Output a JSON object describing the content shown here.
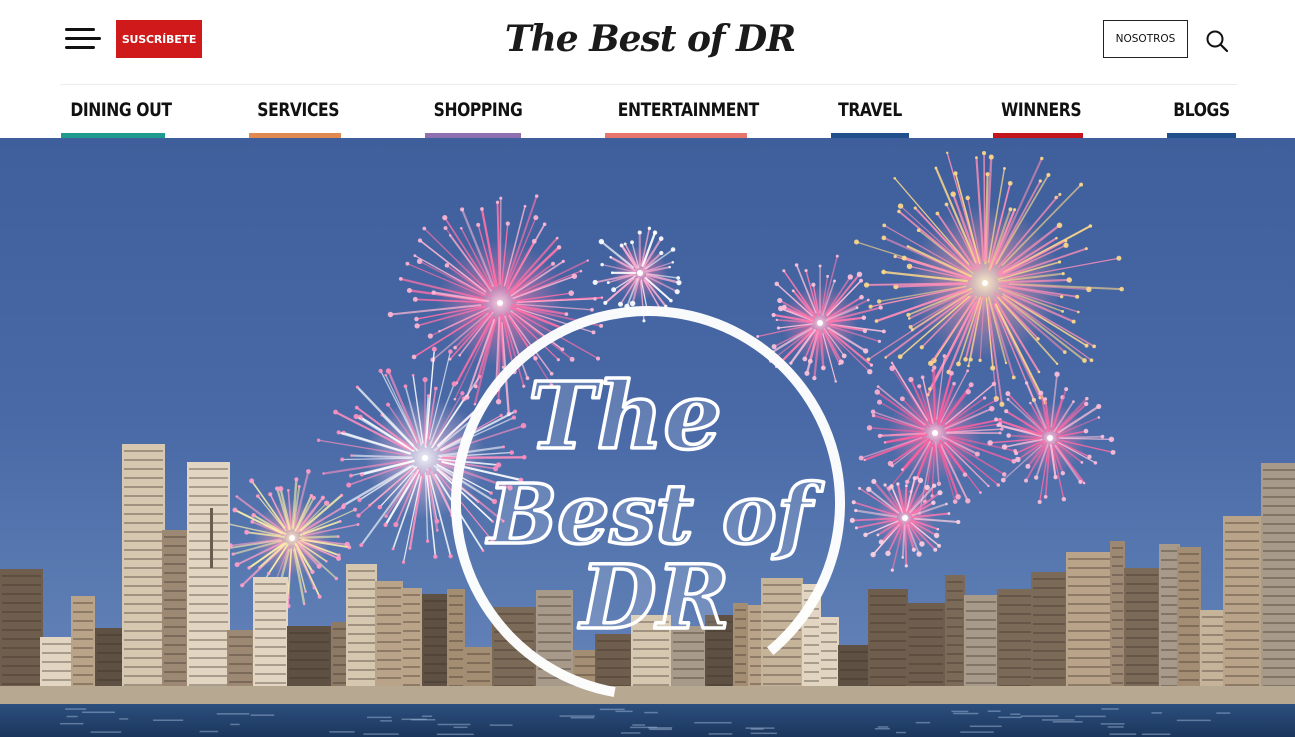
{
  "header": {
    "subscribe_label": "SUSCRÍBETE",
    "logo_text": "The Best of DR",
    "about_label": "NOSOTROS",
    "menu_icon": "hamburger-menu-icon",
    "search_icon": "search-icon"
  },
  "nav": {
    "items": [
      {
        "label": "DINING OUT",
        "color": "#1f9a8f"
      },
      {
        "label": "SERVICES",
        "color": "#e08a4f"
      },
      {
        "label": "SHOPPING",
        "color": "#8e6fb0"
      },
      {
        "label": "ENTERTAINMENT",
        "color": "#e8746e"
      },
      {
        "label": "TRAVEL",
        "color": "#214f8b"
      },
      {
        "label": "WINNERS",
        "color": "#c3161c"
      },
      {
        "label": "BLOGS",
        "color": "#214f8b"
      }
    ]
  },
  "hero": {
    "logo_text": [
      "The",
      "Best of",
      "DR"
    ]
  }
}
